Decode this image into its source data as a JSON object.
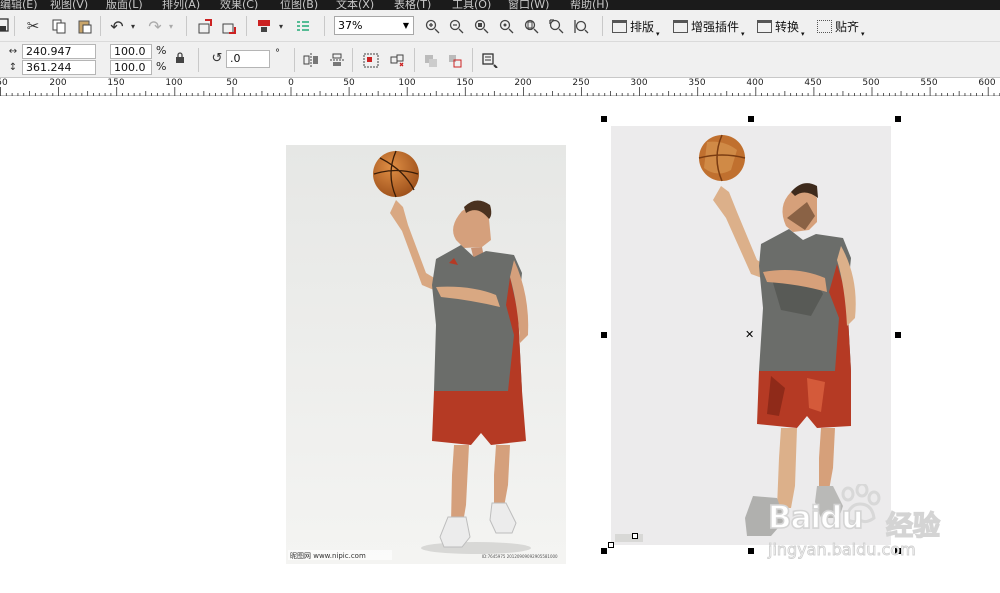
{
  "menu": [
    "编辑(E)",
    "视图(V)",
    "版面(L)",
    "排列(A)",
    "效果(C)",
    "位图(B)",
    "文本(X)",
    "表格(T)",
    "工具(O)",
    "窗口(W)",
    "帮助(H)"
  ],
  "toolbar": {
    "zoom_value": "37%",
    "menu_buttons": [
      "排版",
      "增强插件",
      "转换",
      "贴齐"
    ]
  },
  "property_bar": {
    "width": "240.947 mm",
    "height": "361.244 mm",
    "scale_x": "100.0",
    "scale_y": "100.0",
    "percent": "%",
    "rotation": ".0",
    "degree": "°"
  },
  "ruler": {
    "labels": [
      "50",
      "200",
      "150",
      "100",
      "50",
      "0",
      "50",
      "100",
      "150",
      "200",
      "250",
      "300",
      "350",
      "400",
      "450",
      "500",
      "550",
      "600"
    ]
  },
  "images": {
    "left_watermark": "昵图网 www.nipic.com",
    "left_id": "ID:7645975 20120909092905581000"
  },
  "watermark": {
    "brand": "Baidu",
    "sub": "经验",
    "url": "jingyan.baidu.com"
  },
  "colors": {
    "shirt": "#6b6d6a",
    "shorts": "#b53a24",
    "ball": "#c8742f",
    "skin": "#d9a882"
  }
}
